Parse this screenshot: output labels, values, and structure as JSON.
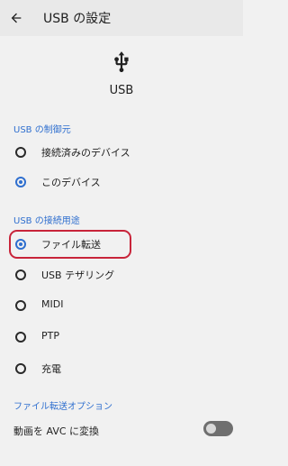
{
  "header": {
    "title": "USB の設定",
    "back_icon": "arrow-left-icon"
  },
  "hero": {
    "icon": "usb-icon",
    "label": "USB"
  },
  "sections": {
    "control_title": "USB の制御元",
    "control_items": [
      {
        "label": "接続済みのデバイス",
        "checked": false
      },
      {
        "label": "このデバイス",
        "checked": true
      }
    ],
    "connection_title": "USB の接続用途",
    "connection_items": [
      {
        "label": "ファイル転送",
        "checked": true
      },
      {
        "label": "USB テザリング",
        "checked": false
      },
      {
        "label": "MIDI",
        "checked": false
      },
      {
        "label": "PTP",
        "checked": false
      },
      {
        "label": "充電",
        "checked": false
      }
    ],
    "options_title": "ファイル転送オプション",
    "option_toggle": {
      "label": "動画を AVC に変換",
      "enabled": false
    }
  },
  "colors": {
    "accent": "#2f6fcf",
    "highlight": "#c8243a"
  }
}
